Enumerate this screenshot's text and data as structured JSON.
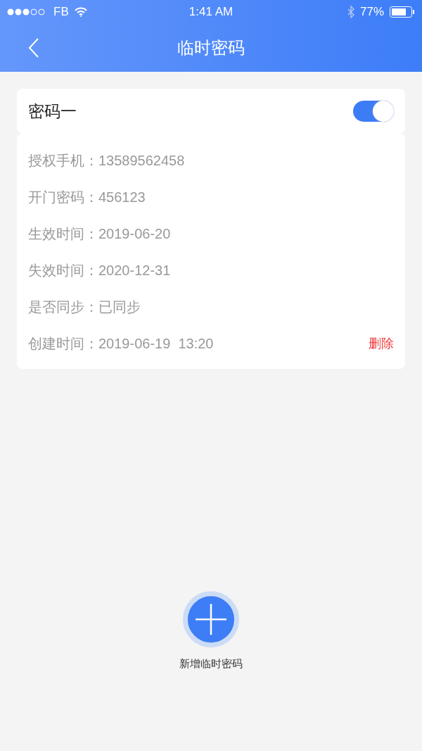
{
  "status_bar": {
    "carrier": "FB",
    "time": "1:41 AM",
    "battery": "77%"
  },
  "nav": {
    "title": "临时密码"
  },
  "password": {
    "name": "密码一",
    "on": true,
    "fields": [
      {
        "label": "授权手机：",
        "value": "13589562458"
      },
      {
        "label": "开门密码：",
        "value": "456123"
      },
      {
        "label": "生效时间：",
        "value": "2019-06-20"
      },
      {
        "label": "失效时间：",
        "value": "2020-12-31"
      },
      {
        "label": "是否同步：",
        "value": "已同步"
      },
      {
        "label": "创建时间：",
        "value": "2019-06-19  13:20"
      }
    ],
    "delete": "删除"
  },
  "add_button": {
    "label": "新增临时密码"
  }
}
